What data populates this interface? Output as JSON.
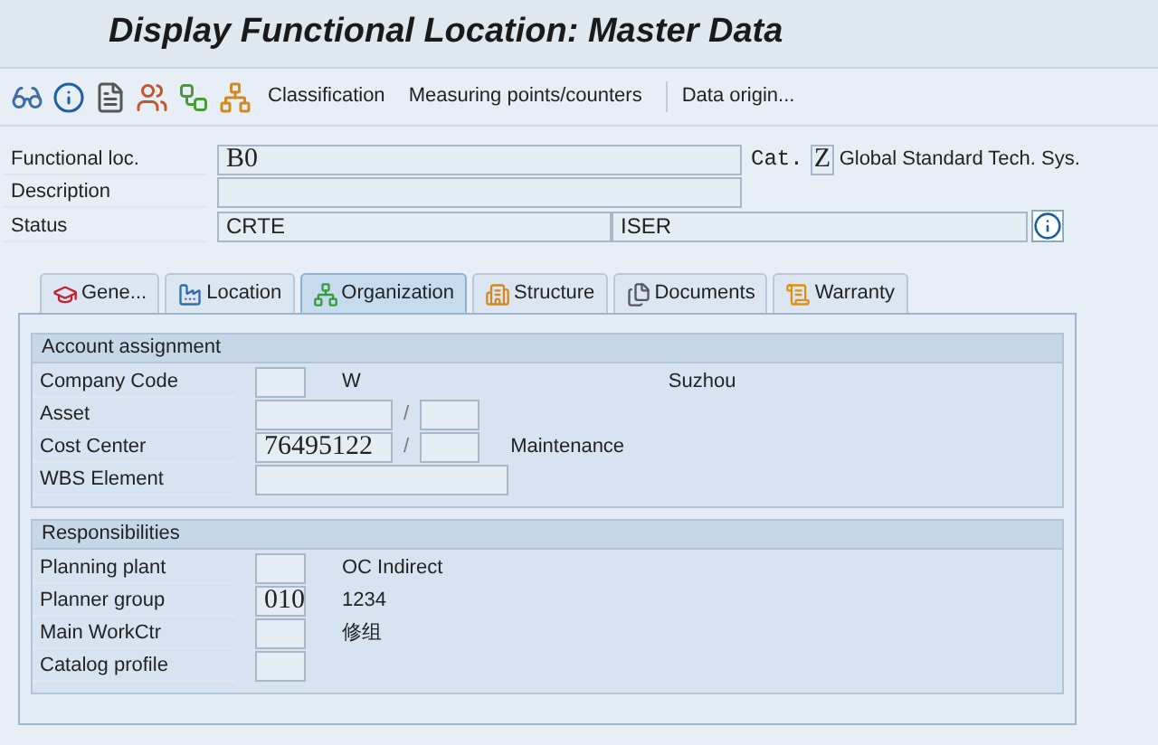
{
  "window": {
    "title": "Display Functional Location: Master Data"
  },
  "toolbar": {
    "buttons": [
      "Classification",
      "Measuring points/counters",
      "Data origin..."
    ]
  },
  "header": {
    "functional_loc": {
      "label": "Functional loc.",
      "value": "B0"
    },
    "cat": {
      "label": "Cat.",
      "value": "Z",
      "text": "Global Standard Tech. Sys."
    },
    "description": {
      "label": "Description"
    },
    "status": {
      "label": "Status",
      "value": "CRTE",
      "user_status": "ISER"
    }
  },
  "tabs": [
    {
      "label": "Gene...",
      "selected": false
    },
    {
      "label": "Location",
      "selected": false
    },
    {
      "label": "Organization",
      "selected": true
    },
    {
      "label": "Structure",
      "selected": false
    },
    {
      "label": "Documents",
      "selected": false
    },
    {
      "label": "Warranty",
      "selected": false
    }
  ],
  "account_assignment": {
    "title": "Account assignment",
    "rows": [
      {
        "label": "Company Code",
        "value": "",
        "text": "W",
        "text_2": "Suzhou"
      },
      {
        "label": "Asset",
        "value": "",
        "separator": "/",
        "value_2": ""
      },
      {
        "label": "Cost Center",
        "value": "76495122",
        "separator": "/",
        "value_2": "",
        "text": "Maintenance"
      },
      {
        "label": "WBS Element",
        "value": ""
      }
    ]
  },
  "responsibilities": {
    "title": "Responsibilities",
    "rows": [
      {
        "label": "Planning plant",
        "value": "",
        "text": "OC Indirect"
      },
      {
        "label": "Planner group",
        "value": "010",
        "text": "1234"
      },
      {
        "label": "Main WorkCtr",
        "value": "",
        "text": "修组"
      },
      {
        "label": "Catalog profile",
        "value": ""
      }
    ]
  }
}
